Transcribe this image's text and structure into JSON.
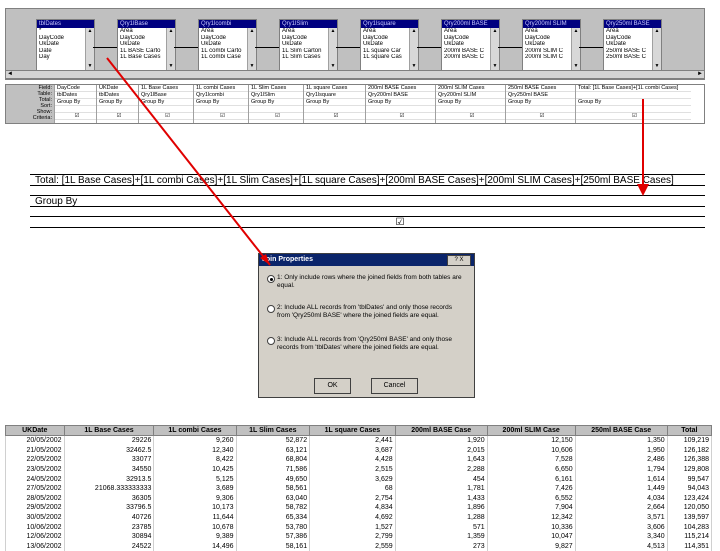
{
  "tables": [
    {
      "title": "tblDates",
      "fields": [
        "*",
        "DayCode",
        "UkDate",
        "Date",
        "Day"
      ]
    },
    {
      "title": "Qry1lBase",
      "fields": [
        "Area",
        "DayCode",
        "UkDate",
        "1L BASE Carto",
        "1L Base Cases"
      ]
    },
    {
      "title": "Qry1lcombi",
      "fields": [
        "Area",
        "DayCode",
        "UkDate",
        "1L combi Carto",
        "1L combi Case"
      ]
    },
    {
      "title": "Qry1lSlim",
      "fields": [
        "Area",
        "DayCode",
        "UkDate",
        "1L Slim Carton",
        "1L Slim Cases"
      ]
    },
    {
      "title": "Qry1lsquare",
      "fields": [
        "Area",
        "DayCode",
        "UkDate",
        "1L square Car",
        "1L square Cas"
      ]
    },
    {
      "title": "Qry200ml BASE",
      "fields": [
        "Area",
        "DayCode",
        "UkDate",
        "200ml BASE C",
        "200ml BASE C"
      ]
    },
    {
      "title": "Qry200ml SLIM",
      "fields": [
        "Area",
        "DayCode",
        "UkDate",
        "200ml SLIM C",
        "200ml SLIM C"
      ]
    },
    {
      "title": "Qry250ml BASE",
      "fields": [
        "Area",
        "DayCode",
        "UkDate",
        "250ml BASE C",
        "250ml BASE C"
      ]
    }
  ],
  "grid": {
    "row_labels": [
      "Field:",
      "Table:",
      "Total:",
      "Sort:",
      "Show:",
      "Criteria:"
    ],
    "columns": [
      {
        "field": "DayCode",
        "table": "tblDates",
        "total": "Group By"
      },
      {
        "field": "UKDate",
        "table": "tblDates",
        "total": "Group By"
      },
      {
        "field": "1L Base Cases",
        "table": "Qry1lBase",
        "total": "Group By"
      },
      {
        "field": "1L combi Cases",
        "table": "Qry1lcombi",
        "total": "Group By"
      },
      {
        "field": "1L Slim Cases",
        "table": "Qry1lSlim",
        "total": "Group By"
      },
      {
        "field": "1L square Cases",
        "table": "Qry1lsquare",
        "total": "Group By"
      },
      {
        "field": "200ml BASE Cases",
        "table": "Qry200ml BASE",
        "total": "Group By"
      },
      {
        "field": "200ml SLIM Cases",
        "table": "Qry200ml SLIM",
        "total": "Group By"
      },
      {
        "field": "250ml BASE Cases",
        "table": "Qry250ml BASE",
        "total": "Group By"
      },
      {
        "field": "Total: [1L Base Cases]+[1L combi Cases]",
        "table": "",
        "total": "Group By"
      }
    ],
    "check": "☑"
  },
  "zoom": {
    "expression": "Total: [1L Base Cases]+[1L combi Cases]+[1L Slim Cases]+[1L square Cases]+[200ml BASE Cases]+[200ml SLIM Cases]+[250ml BASE Cases]",
    "total": "Group By",
    "check": "☑"
  },
  "dialog": {
    "title": "Join Properties",
    "help": "? X",
    "options": [
      "1: Only include rows where the joined fields from both tables are equal.",
      "2: Include ALL records from 'tblDates' and only those records from 'Qry250ml BASE' where the joined fields are equal.",
      "3: Include ALL records from 'Qry250ml BASE' and only those records from 'tblDates' where the joined fields are equal."
    ],
    "ok": "OK",
    "cancel": "Cancel"
  },
  "results": {
    "headers": [
      "UKDate",
      "1L Base Cases",
      "1L combi Cases",
      "1L Slim Cases",
      "1L square Cases",
      "200ml BASE Case",
      "200ml SLIM Case",
      "250ml BASE Case",
      "Total"
    ],
    "rows": [
      [
        "20/05/2002",
        "29226",
        "9,260",
        "52,872",
        "2,441",
        "1,920",
        "12,150",
        "1,350",
        "109,219"
      ],
      [
        "21/05/2002",
        "32462.5",
        "12,340",
        "63,121",
        "3,687",
        "2,015",
        "10,606",
        "1,950",
        "126,182"
      ],
      [
        "22/05/2002",
        "33077",
        "8,422",
        "68,804",
        "4,428",
        "1,643",
        "7,528",
        "2,486",
        "126,388"
      ],
      [
        "23/05/2002",
        "34550",
        "10,425",
        "71,586",
        "2,515",
        "2,288",
        "6,650",
        "1,794",
        "129,808"
      ],
      [
        "24/05/2002",
        "32913.5",
        "5,125",
        "49,650",
        "3,629",
        "454",
        "6,161",
        "1,614",
        "99,547"
      ],
      [
        "27/05/2002",
        "21068.333333333",
        "3,689",
        "58,561",
        "68",
        "1,781",
        "7,426",
        "1,449",
        "94,043"
      ],
      [
        "28/05/2002",
        "36305",
        "9,306",
        "63,040",
        "2,754",
        "1,433",
        "6,552",
        "4,034",
        "123,424"
      ],
      [
        "29/05/2002",
        "33796.5",
        "10,173",
        "58,782",
        "4,834",
        "1,896",
        "7,904",
        "2,664",
        "120,050"
      ],
      [
        "30/05/2002",
        "40726",
        "11,644",
        "65,334",
        "4,692",
        "1,288",
        "12,342",
        "3,571",
        "139,597"
      ],
      [
        "10/06/2002",
        "23785",
        "10,678",
        "53,780",
        "1,527",
        "571",
        "10,336",
        "3,606",
        "104,283"
      ],
      [
        "12/06/2002",
        "30894",
        "9,389",
        "57,386",
        "2,799",
        "1,359",
        "10,047",
        "3,340",
        "115,214"
      ],
      [
        "13/06/2002",
        "24522",
        "14,496",
        "58,161",
        "2,559",
        "273",
        "9,827",
        "4,513",
        "114,351"
      ]
    ]
  },
  "colors": {
    "arrow": "#e00000",
    "title_bar": "#0a246a"
  }
}
